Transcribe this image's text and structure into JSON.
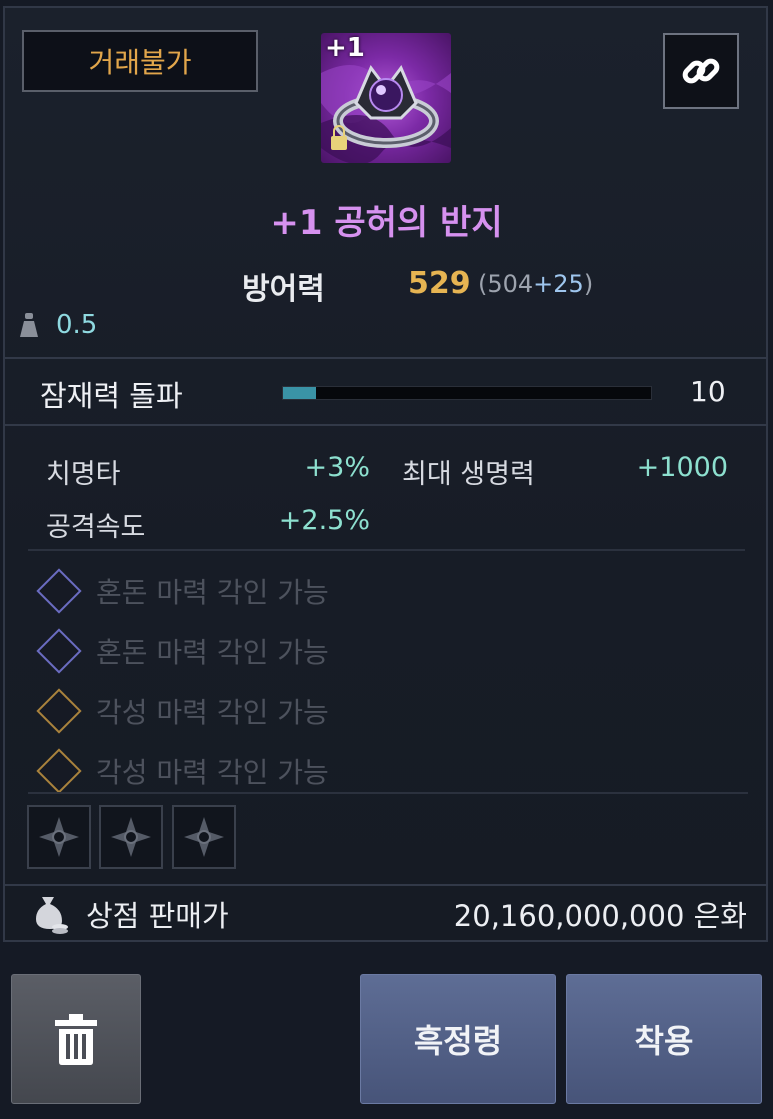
{
  "header": {
    "trade_badge": "거래불가",
    "item_icon_name": "ring-icon",
    "item_enhance_overlay": "+1"
  },
  "item": {
    "name": "+1 공허의 반지",
    "name_color": "#d691ef",
    "defense_label": "방어력",
    "defense_value": "529",
    "defense_breakdown_open": "(504",
    "defense_breakdown_bonus": "+25",
    "defense_breakdown_close": ")",
    "weight": "0.5"
  },
  "potential": {
    "label": "잠재력 돌파",
    "value": "10",
    "progress_fraction": 0.09
  },
  "stats": [
    {
      "label": "치명타",
      "value": "+3%"
    },
    {
      "label": "최대 생명력",
      "value": "+1000"
    },
    {
      "label": "공격속도",
      "value": "+2.5%"
    }
  ],
  "engravings": [
    {
      "label": "혼돈 마력 각인 가능",
      "type": "chaos",
      "color": "#6a6cc0"
    },
    {
      "label": "혼돈 마력 각인 가능",
      "type": "chaos",
      "color": "#6a6cc0"
    },
    {
      "label": "각성 마력 각인 가능",
      "type": "awakening",
      "color": "#a8823d"
    },
    {
      "label": "각성 마력 각인 가능",
      "type": "awakening",
      "color": "#a8823d"
    }
  ],
  "sockets": [
    {
      "icon": "rune-socket-icon"
    },
    {
      "icon": "rune-socket-icon"
    },
    {
      "icon": "rune-socket-icon"
    }
  ],
  "shop": {
    "label": "상점 판매가",
    "value": "20,160,000,000 은화"
  },
  "buttons": {
    "trash_icon": "trash-icon",
    "black_spirit": "흑정령",
    "equip": "착용"
  },
  "colors": {
    "accent_gold": "#e6b452",
    "stat_teal": "#8de0cf",
    "button_blue": "#475479"
  }
}
